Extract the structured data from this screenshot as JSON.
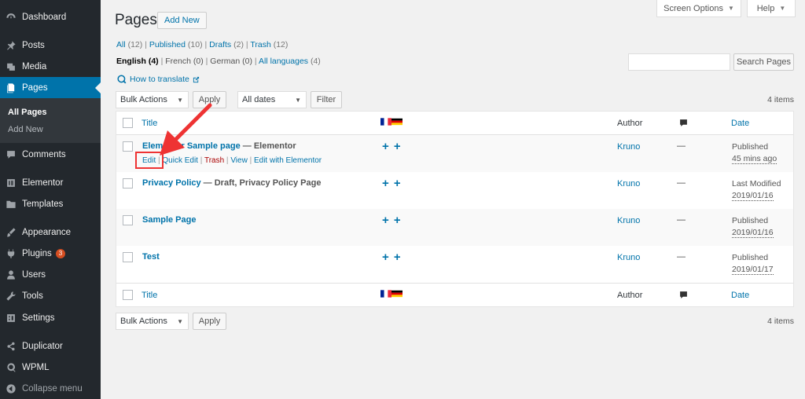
{
  "sidebar": {
    "items": [
      {
        "label": "Dashboard",
        "icon": "dashboard-icon"
      },
      {
        "label": "Posts",
        "icon": "pin-icon"
      },
      {
        "label": "Media",
        "icon": "media-icon"
      },
      {
        "label": "Pages",
        "icon": "pages-icon"
      },
      {
        "label": "Comments",
        "icon": "comments-icon"
      },
      {
        "label": "Elementor",
        "icon": "elementor-icon"
      },
      {
        "label": "Templates",
        "icon": "folder-icon"
      },
      {
        "label": "Appearance",
        "icon": "brush-icon"
      },
      {
        "label": "Plugins",
        "icon": "plugin-icon",
        "badge": "3"
      },
      {
        "label": "Users",
        "icon": "users-icon"
      },
      {
        "label": "Tools",
        "icon": "wrench-icon"
      },
      {
        "label": "Settings",
        "icon": "settings-icon"
      },
      {
        "label": "Duplicator",
        "icon": "duplicator-icon"
      },
      {
        "label": "WPML",
        "icon": "wpml-icon"
      }
    ],
    "submenu": {
      "all_pages": "All Pages",
      "add_new": "Add New"
    },
    "collapse": "Collapse menu"
  },
  "screen_options": "Screen Options",
  "help": "Help",
  "page_title": "Pages",
  "add_new": "Add New",
  "status_filters": {
    "all": "All",
    "all_count": "(12)",
    "published": "Published",
    "published_count": "(10)",
    "drafts": "Drafts",
    "drafts_count": "(2)",
    "trash": "Trash",
    "trash_count": "(12)"
  },
  "language_filters": {
    "english": "English",
    "english_count": "(4)",
    "french": "French",
    "french_count": "(0)",
    "german": "German",
    "german_count": "(0)",
    "all_languages": "All languages",
    "all_languages_count": "(4)"
  },
  "how_to_translate": "How to translate",
  "search": {
    "button": "Search Pages",
    "value": ""
  },
  "bulk_actions": "Bulk Actions",
  "apply": "Apply",
  "all_dates": "All dates",
  "filter": "Filter",
  "items_count": "4 items",
  "table": {
    "headers": {
      "title": "Title",
      "author": "Author",
      "date": "Date"
    },
    "rows": [
      {
        "title": "Elementor Sample page",
        "state": "— Elementor",
        "author": "Kruno",
        "comments": "—",
        "status": "Published",
        "time": "45 mins ago",
        "actions": {
          "edit": "Edit",
          "quick_edit": "Quick Edit",
          "trash": "Trash",
          "view": "View",
          "edit_elementor": "Edit with Elementor"
        }
      },
      {
        "title": "Privacy Policy",
        "state": "— Draft, Privacy Policy Page",
        "author": "Kruno",
        "comments": "—",
        "status": "Last Modified",
        "time": "2019/01/16"
      },
      {
        "title": "Sample Page",
        "state": "",
        "author": "Kruno",
        "comments": "—",
        "status": "Published",
        "time": "2019/01/16"
      },
      {
        "title": "Test",
        "state": "",
        "author": "Kruno",
        "comments": "—",
        "status": "Published",
        "time": "2019/01/17"
      }
    ],
    "add_translation": "+"
  },
  "colors": {
    "accent": "#0073aa",
    "sidebar": "#23282d",
    "annotation": "#e33333"
  }
}
